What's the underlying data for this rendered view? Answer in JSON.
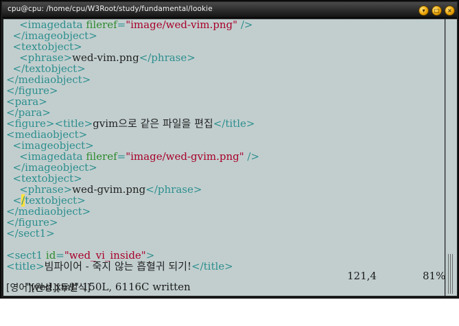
{
  "window": {
    "title": "cpu@cpu: /home/cpu/W3Root/study/fundamental/lookie",
    "buttons": [
      "minimize",
      "maximize",
      "close"
    ]
  },
  "lines": [
    {
      "indent": "    ",
      "parts": [
        {
          "k": "tag",
          "t": "<imagedata "
        },
        {
          "k": "attr",
          "t": "fileref"
        },
        {
          "k": "tag",
          "t": "="
        },
        {
          "k": "str",
          "t": "\"image/wed-vim.png\""
        },
        {
          "k": "tag",
          "t": " />"
        }
      ]
    },
    {
      "indent": "  ",
      "parts": [
        {
          "k": "tag",
          "t": "</imageobject>"
        }
      ]
    },
    {
      "indent": "  ",
      "parts": [
        {
          "k": "tag",
          "t": "<textobject>"
        }
      ]
    },
    {
      "indent": "    ",
      "parts": [
        {
          "k": "tag",
          "t": "<phrase>"
        },
        {
          "k": "txt",
          "t": "wed-vim.png"
        },
        {
          "k": "tag",
          "t": "</phrase>"
        }
      ]
    },
    {
      "indent": "  ",
      "parts": [
        {
          "k": "tag",
          "t": "</textobject>"
        }
      ]
    },
    {
      "indent": "",
      "parts": [
        {
          "k": "tag",
          "t": "</mediaobject>"
        }
      ]
    },
    {
      "indent": "",
      "parts": [
        {
          "k": "tag",
          "t": "</figure>"
        }
      ]
    },
    {
      "indent": "",
      "parts": [
        {
          "k": "tag",
          "t": "<para>"
        }
      ]
    },
    {
      "indent": "",
      "parts": [
        {
          "k": "tag",
          "t": "</para>"
        }
      ]
    },
    {
      "indent": "",
      "parts": [
        {
          "k": "tag",
          "t": "<figure><title>"
        },
        {
          "k": "txt",
          "t": "gvim으로 같은 파일을 편집"
        },
        {
          "k": "tag",
          "t": "</title>"
        }
      ]
    },
    {
      "indent": "",
      "parts": [
        {
          "k": "tag",
          "t": "<mediaobject>"
        }
      ]
    },
    {
      "indent": "  ",
      "parts": [
        {
          "k": "tag",
          "t": "<imageobject>"
        }
      ]
    },
    {
      "indent": "    ",
      "parts": [
        {
          "k": "tag",
          "t": "<imagedata "
        },
        {
          "k": "attr",
          "t": "fileref"
        },
        {
          "k": "tag",
          "t": "="
        },
        {
          "k": "str",
          "t": "\"image/wed-gvim.png\""
        },
        {
          "k": "tag",
          "t": " />"
        }
      ]
    },
    {
      "indent": "  ",
      "parts": [
        {
          "k": "tag",
          "t": "</imageobject>"
        }
      ]
    },
    {
      "indent": "  ",
      "parts": [
        {
          "k": "tag",
          "t": "<textobject>"
        }
      ]
    },
    {
      "indent": "    ",
      "parts": [
        {
          "k": "tag",
          "t": "<phrase>"
        },
        {
          "k": "txt",
          "t": "wed-gvim.png"
        },
        {
          "k": "tag",
          "t": "</phrase>"
        }
      ]
    },
    {
      "indent": "  ",
      "parts": [
        {
          "k": "tag",
          "t": "<"
        },
        {
          "k": "cursor",
          "t": "/"
        },
        {
          "k": "tag",
          "t": "textobject>"
        }
      ]
    },
    {
      "indent": "",
      "parts": [
        {
          "k": "tag",
          "t": "</mediaobject>"
        }
      ]
    },
    {
      "indent": "",
      "parts": [
        {
          "k": "tag",
          "t": "</figure>"
        }
      ]
    },
    {
      "indent": "",
      "parts": [
        {
          "k": "tag",
          "t": "</sect1>"
        }
      ]
    },
    {
      "indent": "",
      "parts": []
    },
    {
      "indent": "",
      "parts": [
        {
          "k": "tag",
          "t": "<sect1 "
        },
        {
          "k": "attr",
          "t": "id"
        },
        {
          "k": "tag",
          "t": "="
        },
        {
          "k": "str",
          "t": "\"wed_vi_inside\""
        },
        {
          "k": "tag",
          "t": ">"
        }
      ]
    },
    {
      "indent": "",
      "parts": [
        {
          "k": "tag",
          "t": "<title>"
        },
        {
          "k": "txt",
          "t": "빔파이어 - 죽지 않는 흡혈귀 되기!"
        },
        {
          "k": "tag",
          "t": "</title>"
        }
      ]
    }
  ],
  "status": {
    "message": "\"wed.xml\" 150L, 6116C written",
    "position": "121,4",
    "percent": "81%"
  },
  "ime": "[영어][완성][두벌식]",
  "colors": {
    "background": "#c2cece",
    "tag": "#2c8e8e",
    "attribute": "#2e8b2e",
    "string": "#a8002a",
    "cursor": "#ffe23c"
  }
}
